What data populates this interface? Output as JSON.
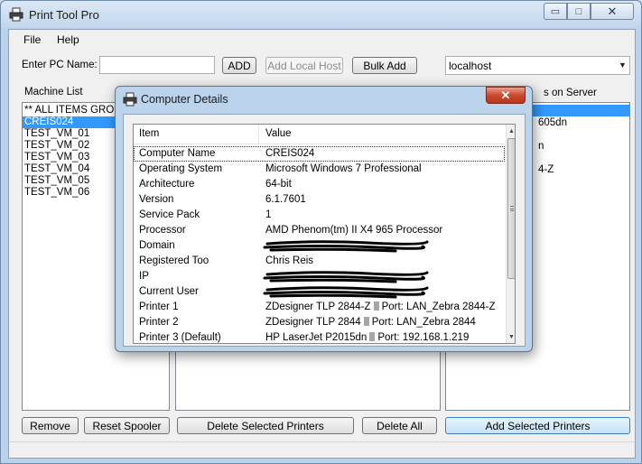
{
  "window": {
    "title": "Print Tool Pro",
    "min_glyph": "▭",
    "max_glyph": "□",
    "close_glyph": "✕"
  },
  "menu": [
    {
      "label": "File"
    },
    {
      "label": "Help"
    }
  ],
  "toolbar": {
    "pc_name_label": "Enter PC Name:",
    "pc_name_value": "",
    "add_label": "ADD",
    "add_local_host_label": "Add Local Host",
    "bulk_add_label": "Bulk Add",
    "host_select_value": "localhost"
  },
  "machine_list": {
    "label": "Machine List",
    "items": [
      {
        "text": "** ALL ITEMS GROU"
      },
      {
        "text": "CREIS024",
        "selected": true
      },
      {
        "text": "TEST_VM_01"
      },
      {
        "text": "TEST_VM_02"
      },
      {
        "text": "TEST_VM_03"
      },
      {
        "text": "TEST_VM_04"
      },
      {
        "text": "TEST_VM_05"
      },
      {
        "text": "TEST_VM_06"
      }
    ]
  },
  "server_list": {
    "label_visible_part": "s on Server",
    "items_visible_part": [
      "605dn",
      "n",
      "4-Z"
    ]
  },
  "bottom_buttons": {
    "remove": "Remove",
    "reset_spooler": "Reset Spooler",
    "delete_selected": "Delete Selected Printers",
    "delete_all": "Delete All",
    "add_selected": "Add Selected Printers"
  },
  "dialog": {
    "title": "Computer Details",
    "close_glyph": "✕",
    "columns": [
      "Item",
      "Value"
    ],
    "rows": [
      {
        "item": "Computer Name",
        "value": "CREIS024"
      },
      {
        "item": "Operating System",
        "value": "Microsoft Windows 7 Professional"
      },
      {
        "item": "Architecture",
        "value": "64-bit"
      },
      {
        "item": "Version",
        "value": "6.1.7601"
      },
      {
        "item": "Service Pack",
        "value": "1"
      },
      {
        "item": "Processor",
        "value": "AMD Phenom(tm) II X4 965 Processor"
      },
      {
        "item": "Domain",
        "value": ""
      },
      {
        "item": "Registered Too",
        "value": "Chris Reis"
      },
      {
        "item": "IP",
        "value": ""
      },
      {
        "item": "Current User",
        "value": ""
      },
      {
        "item": "Printer 1",
        "value_a": "ZDesigner TLP 2844-Z",
        "value_b": "Port: LAN_Zebra 2844-Z"
      },
      {
        "item": "Printer 2",
        "value_a": "ZDesigner TLP 2844",
        "value_b": "Port: LAN_Zebra 2844"
      },
      {
        "item": "Printer 3 (Default)",
        "value_a": "HP LaserJet P2015dn",
        "value_b": "Port: 192.168.1.219"
      }
    ]
  }
}
